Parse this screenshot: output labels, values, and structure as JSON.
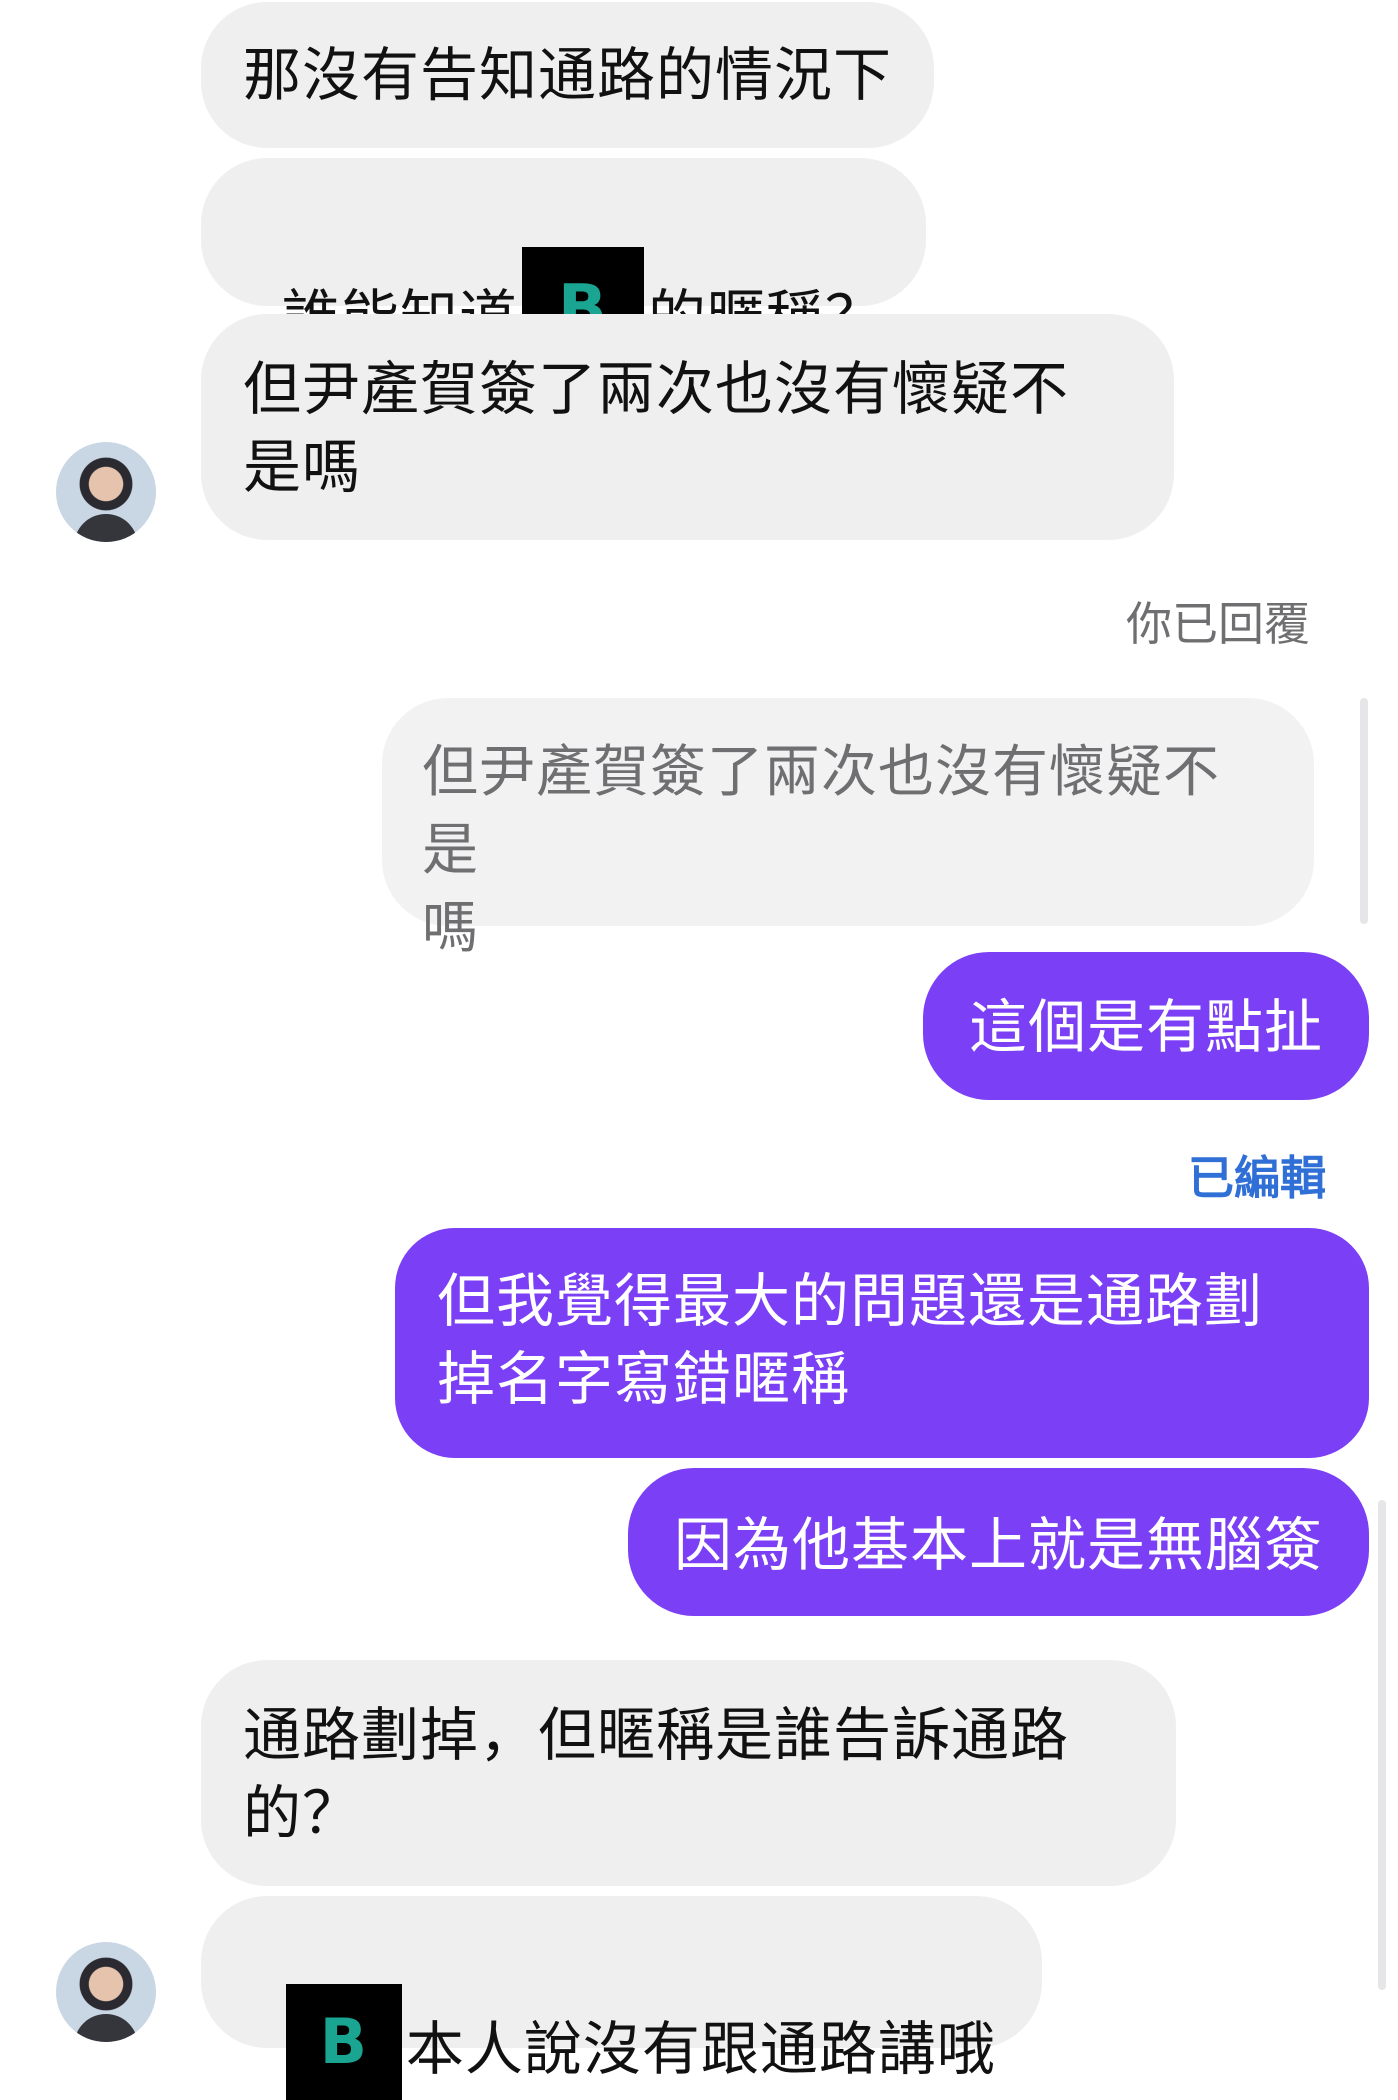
{
  "thread": {
    "msg1": "那沒有告知通路的情況下",
    "msg2_before": "誰能知道",
    "msg2_redacted": "B",
    "msg2_after": "的暱稱？",
    "msg3": "但尹產賀簽了兩次也沒有懷疑不\n是嗎",
    "reply_label": "你已回覆",
    "quoted": "但尹產賀簽了兩次也沒有懷疑不是\n嗎",
    "msg4": "這個是有點扯",
    "edited_label": "已編輯",
    "msg5": "但我覺得最大的問題還是通路劃\n掉名字寫錯暱稱",
    "msg6": "因為他基本上就是無腦簽",
    "msg7": "通路劃掉，但暱稱是誰告訴通路\n的？",
    "msg8_redacted": "B",
    "msg8_after": "本人說沒有跟通路講哦"
  },
  "colors": {
    "outgoing": "#7b3ff6",
    "incoming": "#efeff0",
    "edited_label": "#2f6fd6",
    "redaction_text": "#19a592"
  }
}
